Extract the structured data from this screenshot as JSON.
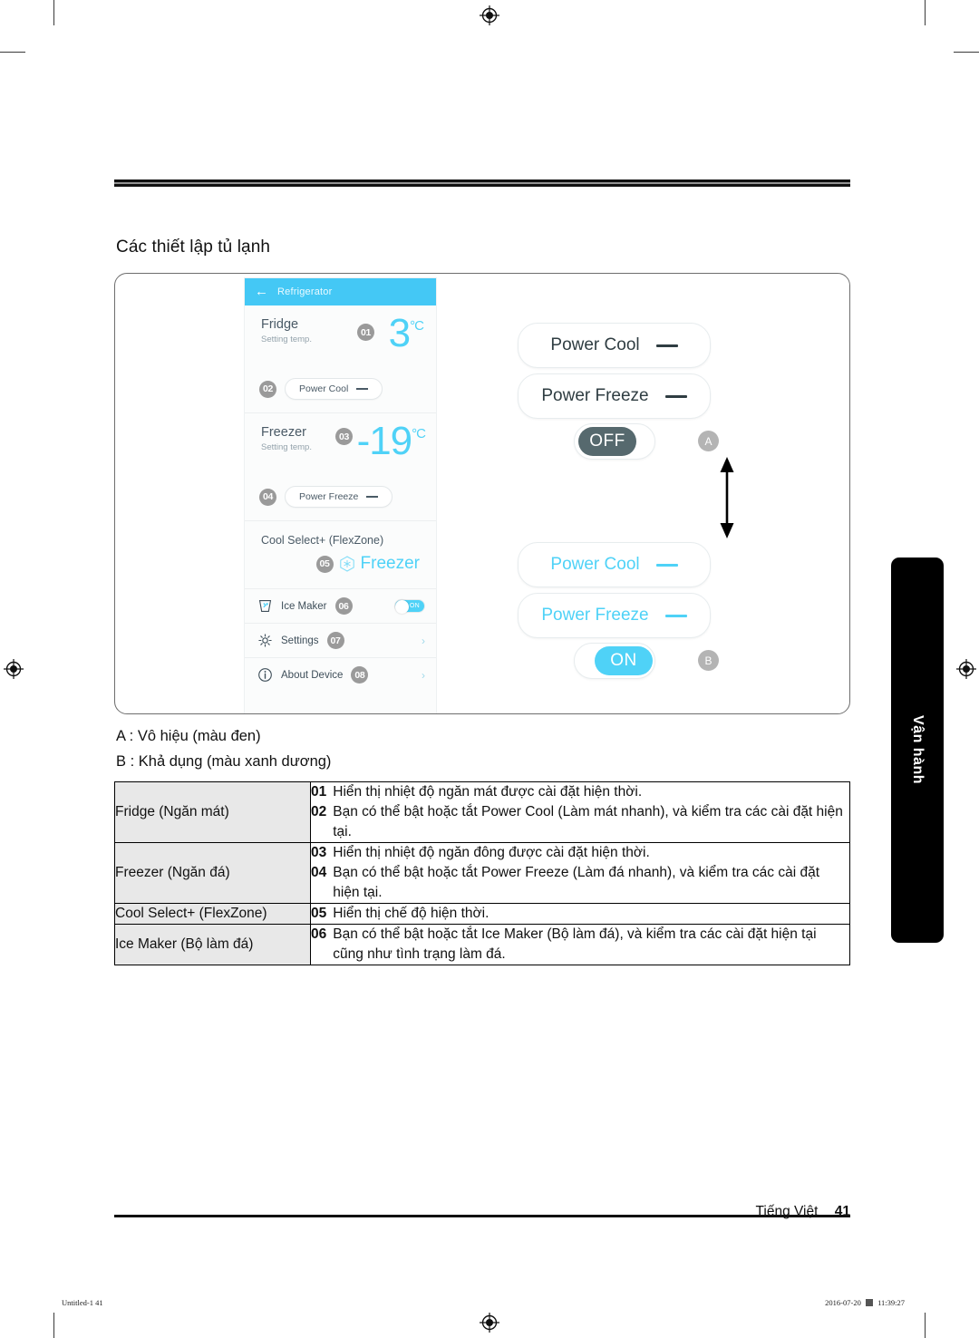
{
  "section": {
    "title": "Các thiết lập tủ lạnh"
  },
  "phone": {
    "appbar": {
      "back_icon": "back-arrow-icon",
      "title": "Refrigerator"
    },
    "fridge": {
      "label": "Fridge",
      "sub": "Setting temp.",
      "badge": "01",
      "value": "3",
      "unit": "°C",
      "pill_badge": "02",
      "pill_label": "Power Cool"
    },
    "freezer": {
      "label": "Freezer",
      "sub": "Setting temp.",
      "badge": "03",
      "value": "-19",
      "unit": "°C",
      "pill_badge": "04",
      "pill_label": "Power Freeze"
    },
    "cool_select": {
      "label": "Cool Select+ (FlexZone)",
      "badge": "05",
      "value": "Freezer"
    },
    "rows": [
      {
        "icon": "ice-maker-icon",
        "label": "Ice Maker",
        "badge": "06",
        "control": "toggle",
        "toggle_text": "ON"
      },
      {
        "icon": "gear-icon",
        "label": "Settings",
        "badge": "07",
        "control": "chevron"
      },
      {
        "icon": "info-icon",
        "label": "About Device",
        "badge": "08",
        "control": "chevron"
      }
    ]
  },
  "callouts": {
    "group_a": {
      "buttons": [
        "Power Cool",
        "Power Freeze"
      ],
      "state": "OFF",
      "marker": "A"
    },
    "group_b": {
      "buttons": [
        "Power Cool",
        "Power Freeze"
      ],
      "state": "ON",
      "marker": "B"
    },
    "arrow_icon": "double-arrow-vertical-icon"
  },
  "legend": [
    "A : Vô hiệu (màu đen)",
    "B : Khả dụng (màu xanh dương)"
  ],
  "table": [
    {
      "key": "Fridge (Ngăn mát)",
      "items": [
        {
          "n": "01",
          "t": "Hiển thị nhiệt độ ngăn mát được cài đặt hiện thời."
        },
        {
          "n": "02",
          "t": "Bạn có thể bật hoặc tắt Power Cool (Làm mát nhanh), và kiểm tra các cài đặt hiện tại."
        }
      ]
    },
    {
      "key": "Freezer (Ngăn đá)",
      "items": [
        {
          "n": "03",
          "t": "Hiển thị nhiệt độ ngăn đông được cài đặt hiện thời."
        },
        {
          "n": "04",
          "t": "Bạn có thể bật hoặc tắt Power Freeze (Làm đá nhanh), và kiểm tra các cài đặt hiện tại."
        }
      ]
    },
    {
      "key": "Cool Select+ (FlexZone)",
      "items": [
        {
          "n": "05",
          "t": "Hiển thị chế độ hiện thời."
        }
      ]
    },
    {
      "key": "Ice Maker (Bộ làm đá)",
      "items": [
        {
          "n": "06",
          "t": "Bạn có thể bật hoặc tắt Ice Maker (Bộ làm đá), và kiểm tra các cài đặt hiện tại cũng như tình trạng làm đá."
        }
      ]
    }
  ],
  "sidetab": {
    "label": "Vận hành"
  },
  "footer": {
    "language": "Tiếng Việt",
    "page": "41"
  },
  "printinfo": {
    "left": "Untitled-1   41",
    "right_date": "2016-07-20",
    "right_time": "11:39:27"
  },
  "colors": {
    "accent_blue": "#4fd2f7",
    "bar_blue": "#44c8f5",
    "dark_slate": "#2f3d42",
    "badge_gray": "#9a9a9a"
  }
}
